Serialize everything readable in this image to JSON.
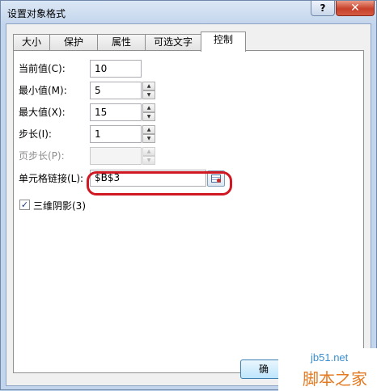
{
  "window": {
    "title": "设置对象格式",
    "help": "?",
    "close": "✕"
  },
  "tabs": [
    {
      "label": "大小"
    },
    {
      "label": "保护"
    },
    {
      "label": "属性"
    },
    {
      "label": "可选文字"
    },
    {
      "label": "控制",
      "active": true
    }
  ],
  "fields": {
    "current_label": "当前值(C):",
    "current_value": "10",
    "min_label": "最小值(M):",
    "min_value": "5",
    "max_label": "最大值(X):",
    "max_value": "15",
    "step_label": "步长(I):",
    "step_value": "1",
    "page_label": "页步长(P):",
    "page_value": "",
    "link_label": "单元格链接(L):",
    "link_value": "$B$3"
  },
  "shading": {
    "label": "三维阴影(3)",
    "checked": true,
    "mark": "✓"
  },
  "buttons": {
    "ok_partial": "确"
  },
  "watermark": {
    "url": "jb51.net",
    "text": "脚本之家"
  },
  "colors": {
    "highlight_ring": "#d01822",
    "title_bg": "#c3d5ec"
  }
}
